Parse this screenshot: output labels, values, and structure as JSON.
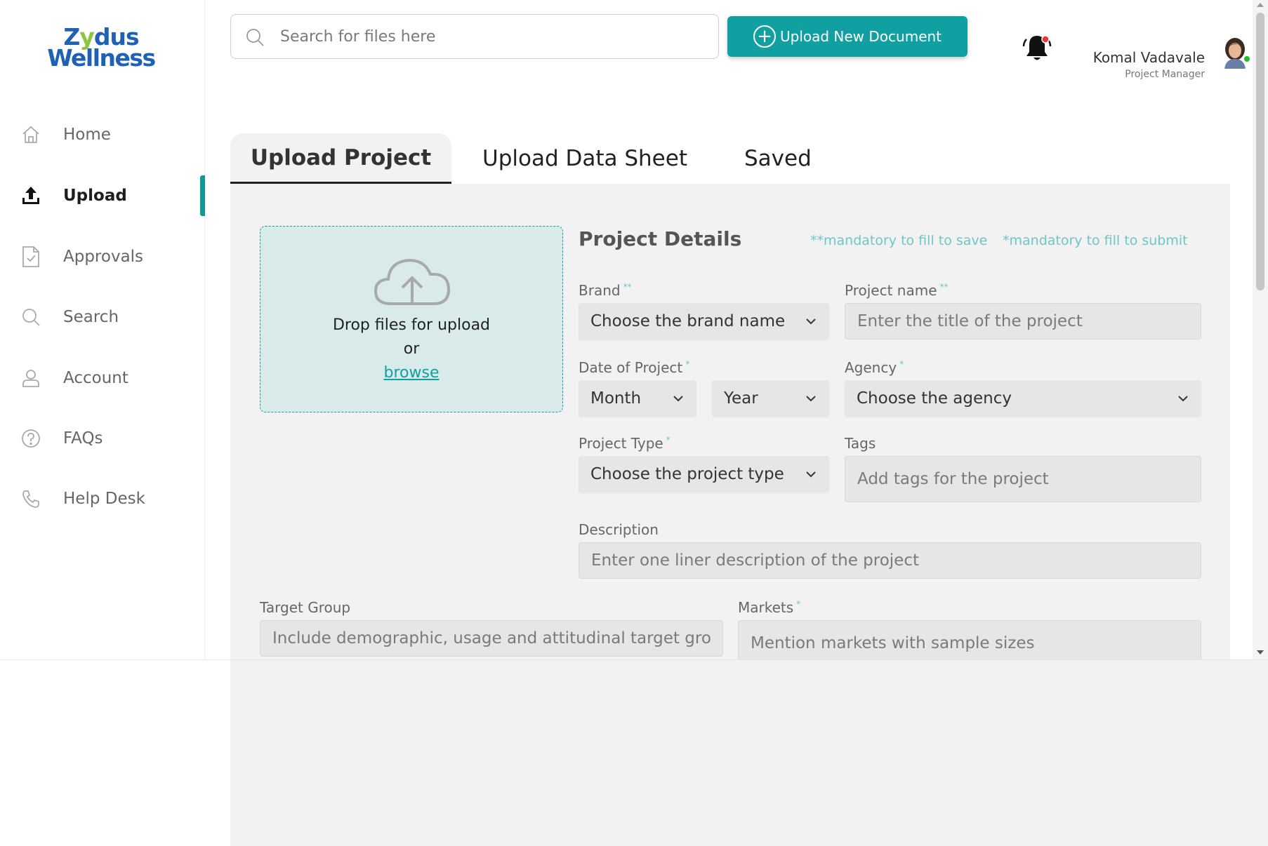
{
  "brand": {
    "logo_line1_pre": "Z",
    "logo_line1_y": "y",
    "logo_line1_post": "dus",
    "logo_line2": "Wellness",
    "primary": "#1f62b5",
    "accent": "#8cc63f",
    "teal": "#11a0a2"
  },
  "sidebar": {
    "items": [
      {
        "label": "Home",
        "icon": "home-icon",
        "active": false
      },
      {
        "label": "Upload",
        "icon": "upload-icon",
        "active": true
      },
      {
        "label": "Approvals",
        "icon": "approvals-icon",
        "active": false
      },
      {
        "label": "Search",
        "icon": "search-icon",
        "active": false
      },
      {
        "label": "Account",
        "icon": "account-icon",
        "active": false
      },
      {
        "label": "FAQs",
        "icon": "faq-icon",
        "active": false
      },
      {
        "label": "Help Desk",
        "icon": "phone-icon",
        "active": false
      }
    ]
  },
  "header": {
    "search_placeholder": "Search for files here",
    "upload_button": "Upload New Document",
    "user_name": "Komal Vadavale",
    "user_role": "Project Manager"
  },
  "tabs": [
    {
      "label": "Upload Project",
      "active": true
    },
    {
      "label": "Upload Data Sheet",
      "active": false
    },
    {
      "label": "Saved",
      "active": false
    }
  ],
  "dropzone": {
    "line1": "Drop files for upload",
    "line2": "or",
    "browse": "browse"
  },
  "form": {
    "title": "Project Details",
    "hint_save": "**mandatory to fill to save",
    "hint_submit": "*mandatory to fill to submit",
    "brand_label": "Brand",
    "brand_star": "**",
    "brand_value": "Choose the brand name",
    "project_name_label": "Project name",
    "project_name_star": "**",
    "project_name_placeholder": "Enter the title of the project",
    "date_label": "Date of Project",
    "date_star": "*",
    "month_value": "Month",
    "year_value": "Year",
    "agency_label": "Agency",
    "agency_star": "*",
    "agency_value": "Choose the agency",
    "project_type_label": "Project Type",
    "project_type_star": "*",
    "project_type_value": "Choose the project type",
    "tags_label": "Tags",
    "tags_placeholder": "Add tags for the project",
    "description_label": "Description",
    "description_placeholder": "Enter one liner description of the project",
    "target_group_label": "Target Group",
    "target_group_placeholder": "Include demographic, usage and attitudinal target group",
    "markets_label": "Markets",
    "markets_star": "*",
    "markets_placeholder": "Mention markets with sample sizes"
  }
}
